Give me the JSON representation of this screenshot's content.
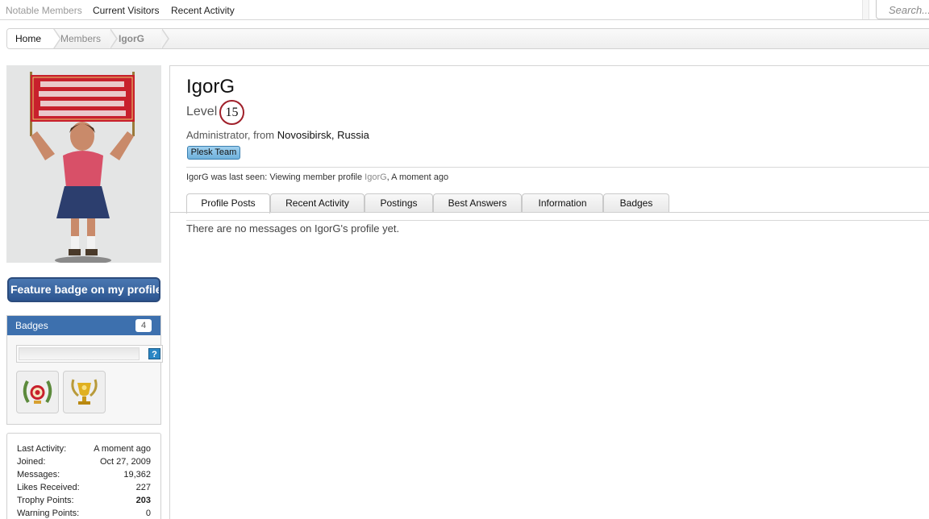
{
  "topnav": {
    "items": [
      "Notable Members",
      "Current Visitors",
      "Recent Activity"
    ],
    "search_placeholder": "Search..."
  },
  "breadcrumb": {
    "home": "Home",
    "members": "Members",
    "user": "IgorG"
  },
  "sidebar": {
    "feature_button": "Feature badge on my profile",
    "badges": {
      "title": "Badges",
      "count": "4",
      "help": "?"
    },
    "stats": [
      {
        "key": "Last Activity:",
        "value": "A moment ago"
      },
      {
        "key": "Joined:",
        "value": "Oct 27, 2009"
      },
      {
        "key": "Messages:",
        "value": "19,362"
      },
      {
        "key": "Likes Received:",
        "value": "227"
      },
      {
        "key": "Trophy Points:",
        "value": "203"
      },
      {
        "key": "Warning Points:",
        "value": "0"
      }
    ]
  },
  "profile": {
    "username": "IgorG",
    "level_label": "Level",
    "level": "15",
    "title_prefix": "Administrator, from",
    "location": "Novosibirsk, Russia",
    "banner": "Plesk Team",
    "last_seen_prefix": "IgorG was last seen:",
    "last_seen_action": "Viewing member profile",
    "last_seen_target": "IgorG",
    "last_seen_time": ", A moment ago",
    "tabs": [
      "Profile Posts",
      "Recent Activity",
      "Postings",
      "Best Answers",
      "Information",
      "Badges"
    ],
    "empty_message": "There are no messages on IgorG's profile yet."
  },
  "colors": {
    "accent": "#3d70ae",
    "level_ring": "#a0202a",
    "banner": "#6fb1dc"
  }
}
